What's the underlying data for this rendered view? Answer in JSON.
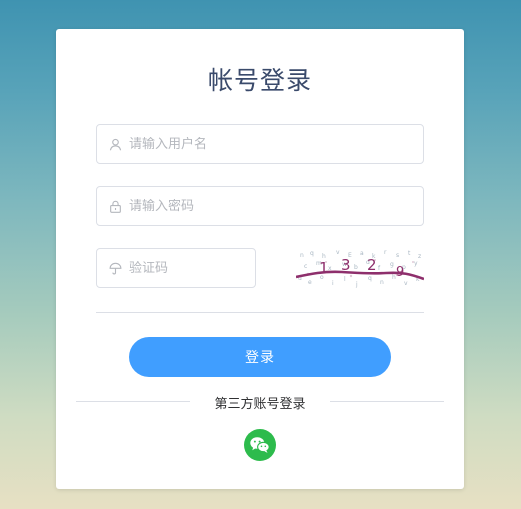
{
  "login": {
    "title": "帐号登录",
    "username_placeholder": "请输入用户名",
    "password_placeholder": "请输入密码",
    "captcha_placeholder": "验证码",
    "captcha_text": "1329",
    "login_button": "登录",
    "third_party_label": "第三方账号登录"
  },
  "icons": {
    "username": "user-icon",
    "password": "lock-icon",
    "captcha": "umbrella-icon",
    "third_party": "wechat-icon"
  },
  "colors": {
    "primary": "#409eff",
    "wechat": "#2dbb4c",
    "title": "#3a4a6b"
  }
}
